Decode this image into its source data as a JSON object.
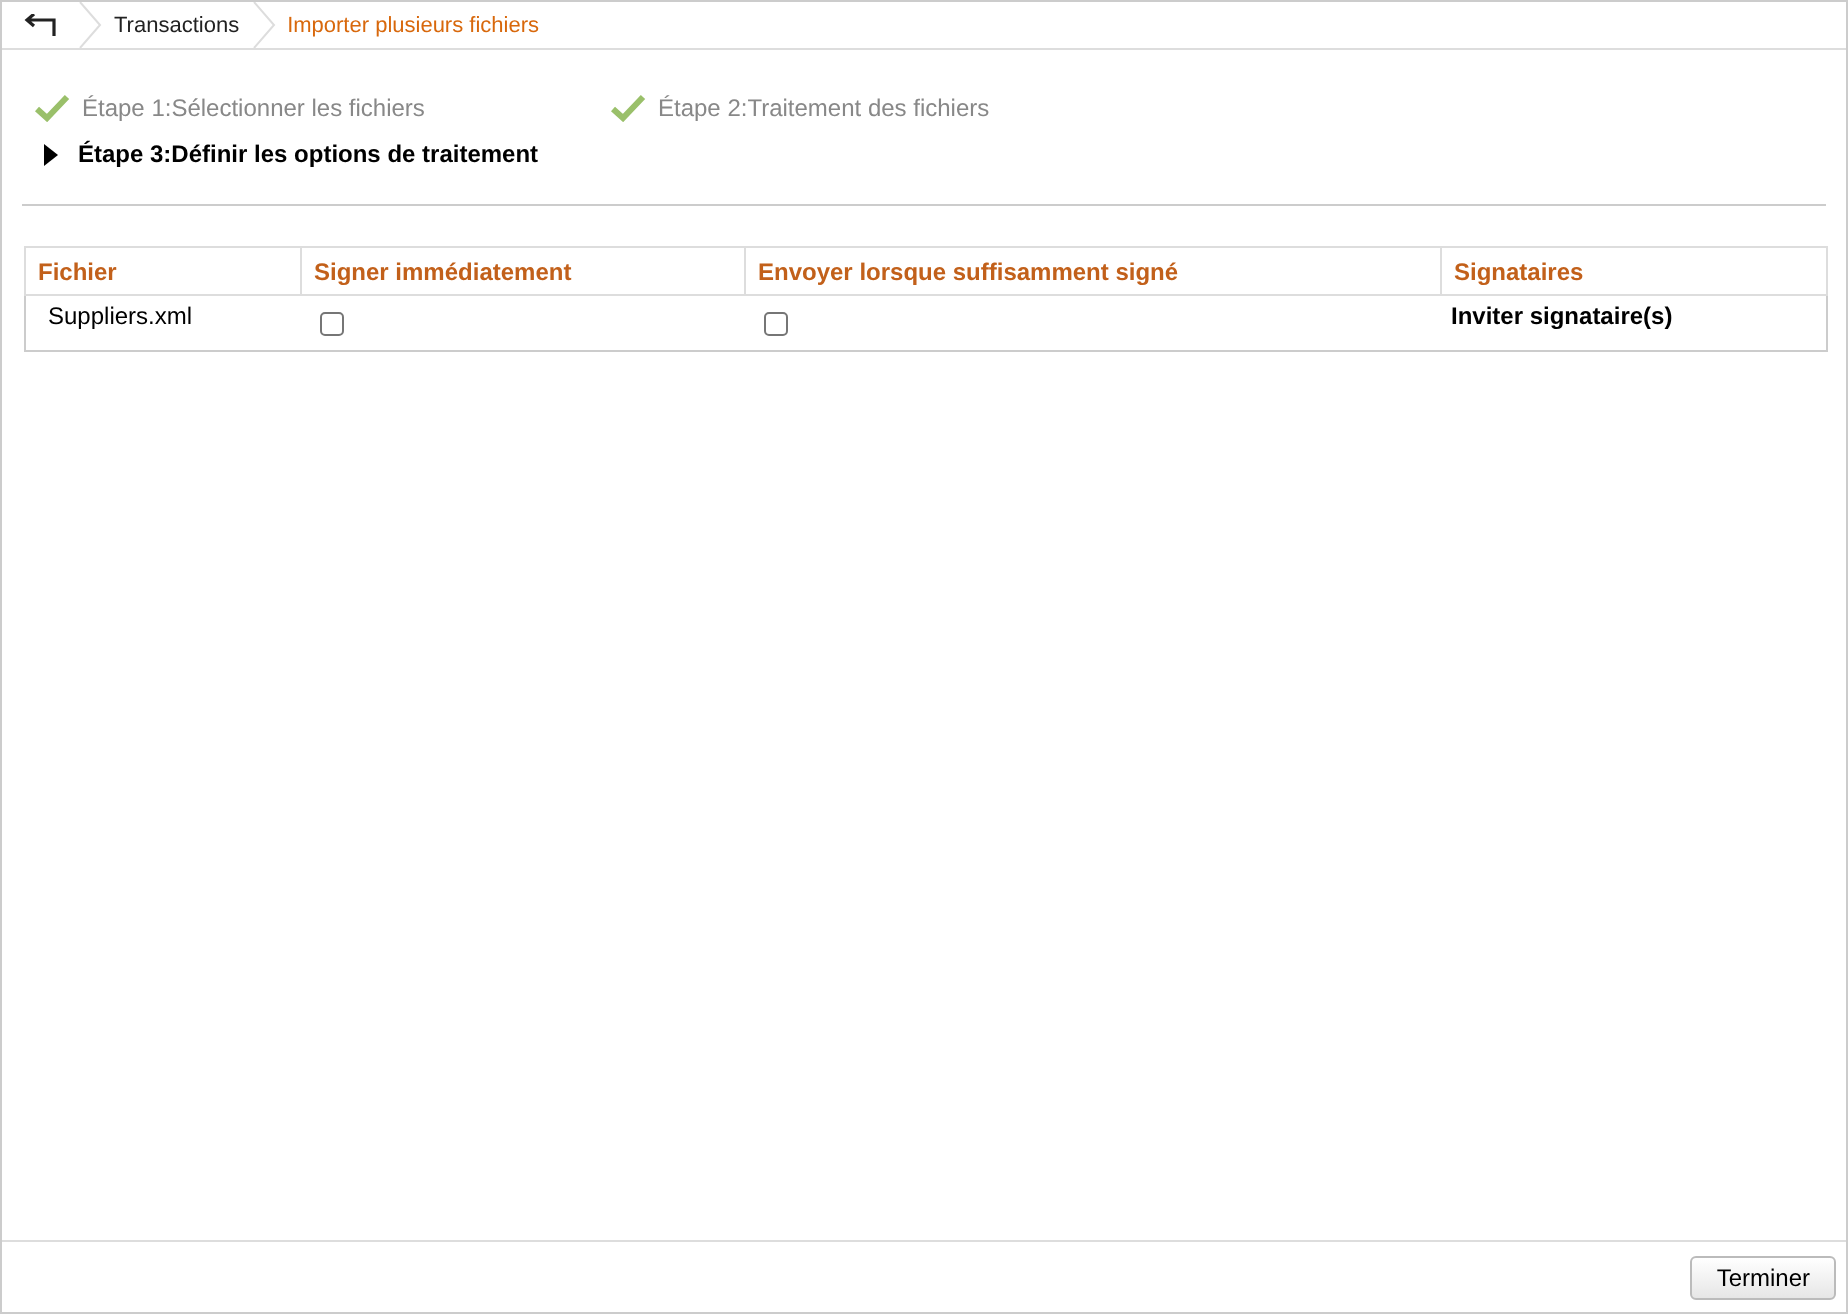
{
  "breadcrumb": [
    {
      "label": "Transactions",
      "selected": false
    },
    {
      "label": "Importer plusieurs fichiers",
      "selected": true
    }
  ],
  "steps": [
    {
      "label": "Étape 1:Sélectionner les fichiers",
      "kind": "done"
    },
    {
      "label": "Étape 2:Traitement des fichiers",
      "kind": "done"
    },
    {
      "label": "Étape 3:Définir les options de traitement",
      "kind": "current"
    }
  ],
  "table": {
    "columns": [
      "Fichier",
      "Signer immédiatement",
      "Envoyer lorsque suffisamment signé",
      "Signataires"
    ],
    "rows": [
      {
        "file": "Suppliers.xml",
        "sign_now": {
          "checked": false
        },
        "send_when_signed": {
          "checked": false
        },
        "signers": "Inviter signataire(s)"
      }
    ]
  },
  "buttons": [
    "Terminer"
  ]
}
